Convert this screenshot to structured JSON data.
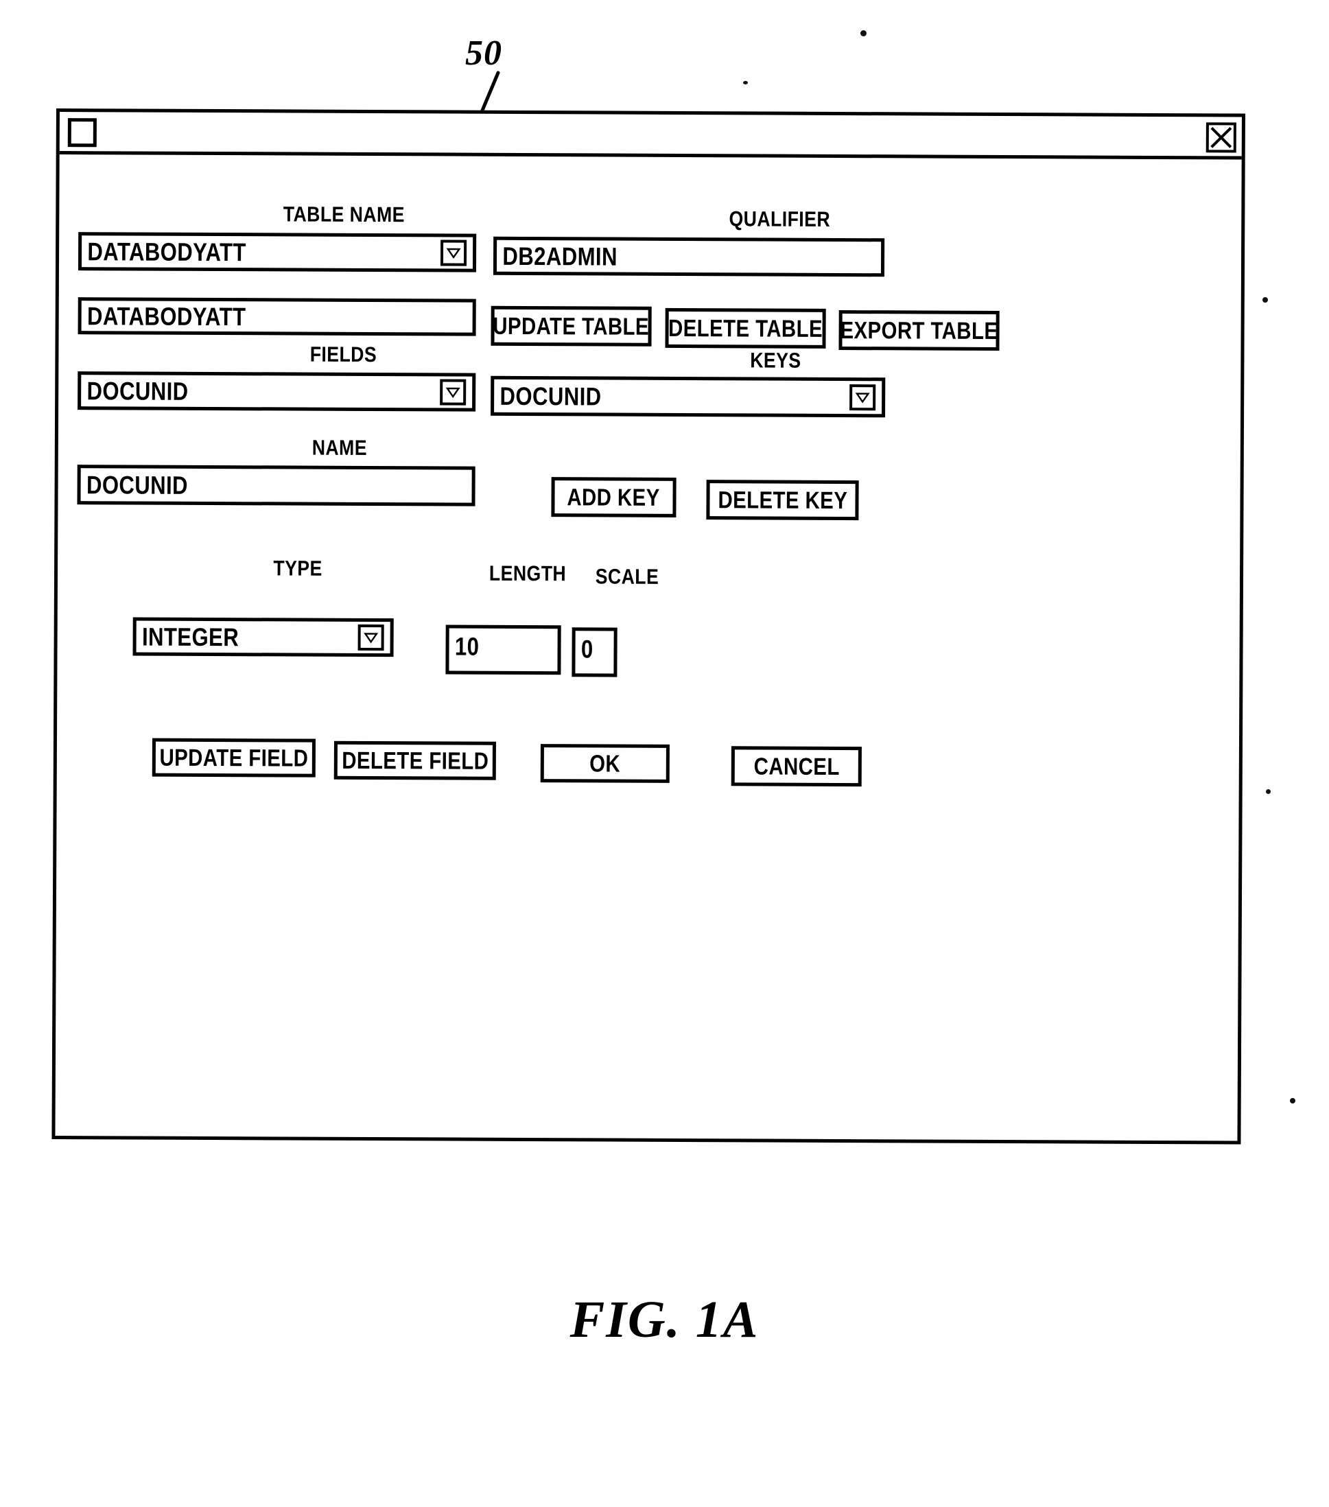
{
  "figure": {
    "reference_numeral": "50",
    "caption": "FIG.  1A"
  },
  "window": {
    "title": "",
    "sysmenu_icon": "system-menu-box",
    "close_icon": "close-x-icon"
  },
  "table_section": {
    "table_name_label": "TABLE NAME",
    "table_name_value": "DATABODYATT",
    "qualifier_label": "QUALIFIER",
    "qualifier_value": "DB2ADMIN",
    "table_alias_value": "DATABODYATT",
    "update_table_button": "UPDATE TABLE",
    "delete_table_button": "DELETE TABLE",
    "export_table_button": "EXPORT TABLE"
  },
  "fields_section": {
    "fields_label": "FIELDS",
    "fields_value": "DOCUNID",
    "keys_label": "KEYS",
    "keys_value": "DOCUNID",
    "name_label": "NAME",
    "name_value": "DOCUNID",
    "add_key_button": "ADD KEY",
    "delete_key_button": "DELETE KEY"
  },
  "type_section": {
    "type_label": "TYPE",
    "type_value": "INTEGER",
    "length_label": "LENGTH",
    "length_value": "10",
    "scale_label": "SCALE",
    "scale_value": "0"
  },
  "actions": {
    "update_field_button": "UPDATE FIELD",
    "delete_field_button": "DELETE FIELD",
    "ok_button": "OK",
    "cancel_button": "CANCEL"
  }
}
